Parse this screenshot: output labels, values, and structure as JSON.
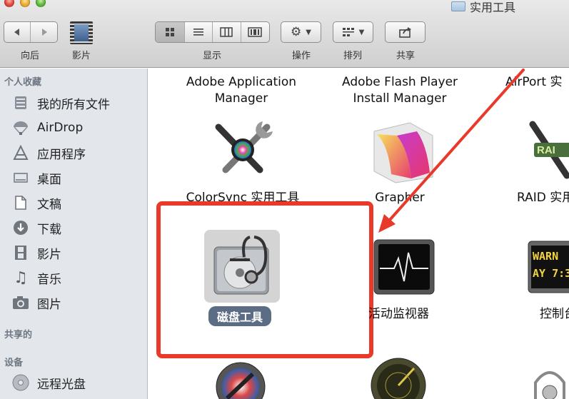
{
  "window": {
    "title": "实用工具",
    "title_icon": "folder-icon"
  },
  "toolbar": {
    "back_label": "向后",
    "movies_label": "影片",
    "view_label": "显示",
    "action_label": "操作",
    "arrange_label": "排列",
    "share_label": "共享"
  },
  "sidebar": {
    "favorites_header": "个人收藏",
    "shared_header": "共享的",
    "devices_header": "设备",
    "items": [
      {
        "label": "我的所有文件",
        "icon": "all-files-icon"
      },
      {
        "label": "AirDrop",
        "icon": "airdrop-icon"
      },
      {
        "label": "应用程序",
        "icon": "applications-icon"
      },
      {
        "label": "桌面",
        "icon": "desktop-icon"
      },
      {
        "label": "文稿",
        "icon": "documents-icon"
      },
      {
        "label": "下载",
        "icon": "downloads-icon"
      },
      {
        "label": "影片",
        "icon": "movies-icon"
      },
      {
        "label": "音乐",
        "icon": "music-icon"
      },
      {
        "label": "图片",
        "icon": "pictures-icon"
      }
    ],
    "devices": [
      {
        "label": "远程光盘",
        "icon": "remote-disc-icon"
      }
    ]
  },
  "apps": {
    "adobe_app_manager_1": "Adobe Application",
    "adobe_app_manager_2": "Manager",
    "adobe_flash_1": "Adobe Flash Player",
    "adobe_flash_2": "Install Manager",
    "airport": "AirPort 实",
    "colorsync": "ColorSync 实用工具",
    "grapher": "Grapher",
    "raid": "RAID 实用",
    "disk_utility": "磁盘工具",
    "activity_monitor": "活动监视器",
    "console": "控制台",
    "console_screen_text_1": "WARN",
    "console_screen_text_2": "AY 7:3"
  },
  "colors": {
    "highlight": "#e8392b",
    "selection_label": "#5b6d84",
    "sidebar_bg": "#e3e7ec"
  }
}
